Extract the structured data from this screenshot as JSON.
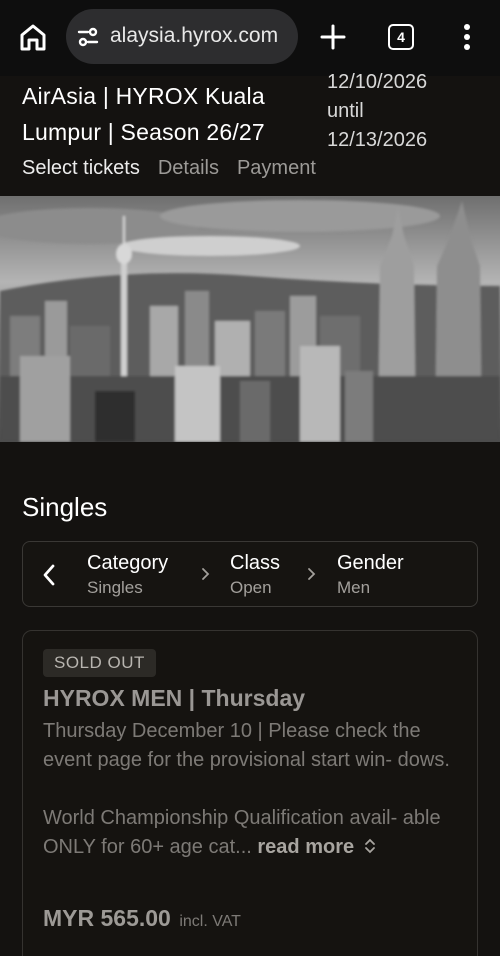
{
  "browser": {
    "url": "alaysia.hyrox.com",
    "tab_count": "4"
  },
  "event": {
    "title": "AirAsia | HYROX Kuala Lumpur | Season 26/27",
    "date_start": "12/10/2026",
    "date_sep": "until",
    "date_end": "12/13/2026"
  },
  "steps": [
    "Select tickets",
    "Details",
    "Payment"
  ],
  "section": {
    "title": "Singles"
  },
  "breadcrumb": {
    "category": {
      "label": "Category",
      "value": "Singles"
    },
    "class": {
      "label": "Class",
      "value": "Open"
    },
    "gender": {
      "label": "Gender",
      "value": "Men"
    }
  },
  "ticket": {
    "badge": "SOLD OUT",
    "title": "HYROX MEN | Thursday",
    "desc1": "Thursday December 10 | Please check the event page for the provisional start win- dows.",
    "desc2": "World Championship Qualification avail- able ONLY for 60+ age cat...",
    "read_more": "read more",
    "price": "MYR 565.00",
    "vat": "incl. VAT"
  },
  "icons": {
    "home": "home-icon",
    "site_info": "tune-icon",
    "new_tab": "plus-icon",
    "menu": "more-vert-icon",
    "back": "chevron-left-icon",
    "separator": "chevron-right-icon",
    "expand": "unfold-icon"
  },
  "colors": {
    "background": "#141210",
    "card_border": "#353330",
    "muted_text": "#7d7a76"
  }
}
